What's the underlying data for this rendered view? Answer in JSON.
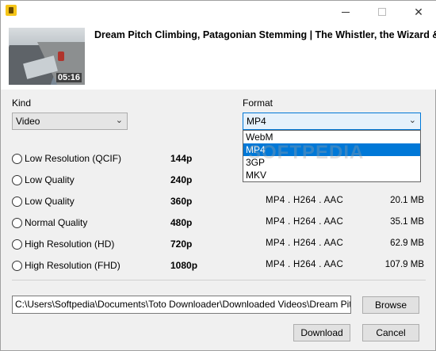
{
  "window": {
    "icon": "toto-downloader-icon"
  },
  "video": {
    "title": "Dream Pitch Climbing, Patagonian Stemming | The Whistler, the Wizard & the",
    "duration": "05:16"
  },
  "kind": {
    "label": "Kind",
    "value": "Video"
  },
  "format": {
    "label": "Format",
    "value": "MP4",
    "options": [
      "WebM",
      "MP4",
      "3GP",
      "MKV"
    ],
    "selected_option": "MP4"
  },
  "watermark": "SOFTPEDIA",
  "qualities": [
    {
      "name": "Low Resolution (QCIF)",
      "resolution": "144p",
      "codec": "",
      "size": ""
    },
    {
      "name": "Low Quality",
      "resolution": "240p",
      "codec": "",
      "size": ""
    },
    {
      "name": "Low Quality",
      "resolution": "360p",
      "codec": "MP4 . H264 . AAC",
      "size": "20.1 MB"
    },
    {
      "name": "Normal Quality",
      "resolution": "480p",
      "codec": "MP4 . H264 . AAC",
      "size": "35.1 MB"
    },
    {
      "name": "High Resolution (HD)",
      "resolution": "720p",
      "codec": "MP4 . H264 . AAC",
      "size": "62.9 MB"
    },
    {
      "name": "High Resolution (FHD)",
      "resolution": "1080p",
      "codec": "MP4 . H264 . AAC",
      "size": "107.9 MB"
    }
  ],
  "output": {
    "path": "C:\\Users\\Softpedia\\Documents\\Toto Downloader\\Downloaded Videos\\Dream Pitch Climbi"
  },
  "buttons": {
    "browse": "Browse",
    "download": "Download",
    "cancel": "Cancel"
  },
  "colors": {
    "accent": "#0078d7",
    "window_bg": "#f0f0f0"
  }
}
